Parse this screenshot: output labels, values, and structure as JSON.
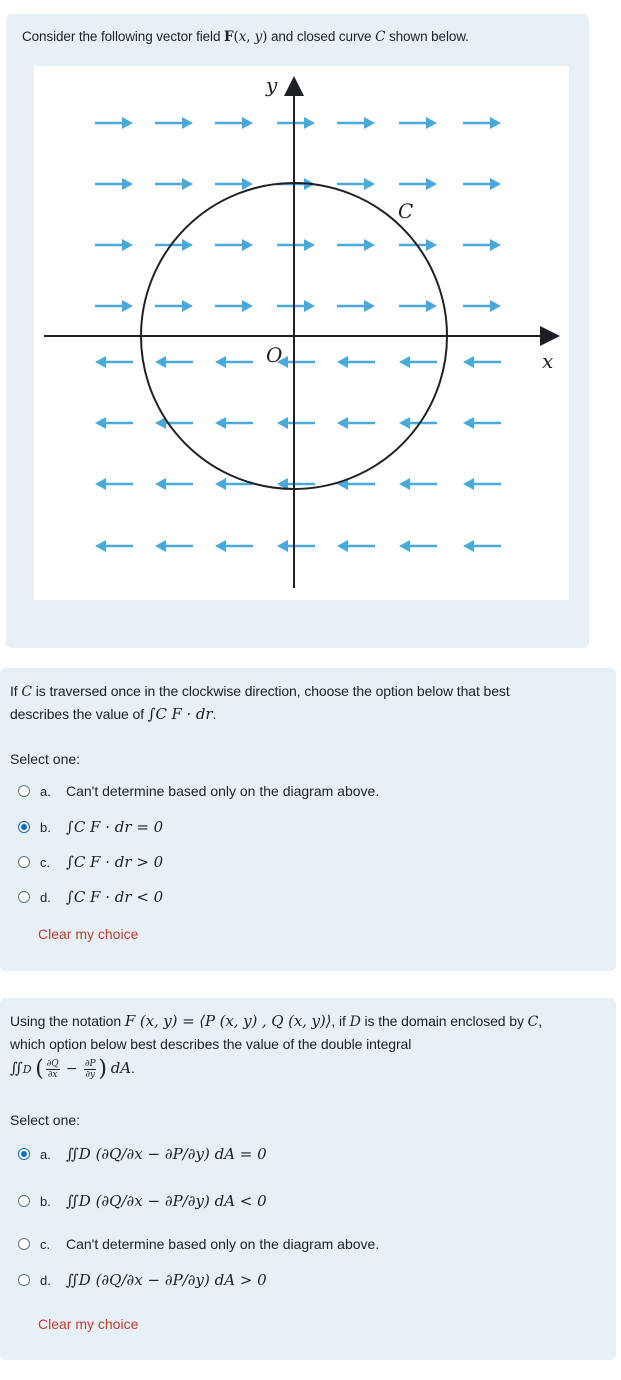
{
  "q1": {
    "prompt_pre": "Consider the following vector field ",
    "prompt_field": "F(x, y)",
    "prompt_mid": " and closed curve ",
    "prompt_curve": "C",
    "prompt_post": " shown below.",
    "diagram": {
      "axis_x": "x",
      "axis_y": "y",
      "origin": "O",
      "curve_label": "C",
      "arrow_color": "#4aa9d9"
    }
  },
  "q2": {
    "line1_pre": "If ",
    "line1_curve": "C",
    "line1_post": " is traversed once in the clockwise direction, choose the option below that best",
    "line2_pre": "describes the value of ",
    "line2_expr": "∫C F · dr",
    "line2_post": ".",
    "select_label": "Select one:",
    "options": [
      {
        "letter": "a.",
        "text": "Can't determine based only on the diagram above.",
        "checked": false
      },
      {
        "letter": "b.",
        "text": "∫C F · dr = 0",
        "checked": true
      },
      {
        "letter": "c.",
        "text": "∫C F · dr > 0",
        "checked": false
      },
      {
        "letter": "d.",
        "text": "∫C F · dr < 0",
        "checked": false
      }
    ],
    "clear_label": "Clear my choice"
  },
  "q3": {
    "line1_pre": "Using the notation ",
    "line1_expr": "F (x, y) = ⟨P (x, y) , Q (x, y)⟩",
    "line1_mid": ", if ",
    "line1_domain": "D",
    "line1_post": " is the domain enclosed by ",
    "line1_curve": "C",
    "line1_end": ",",
    "line2": "which option below best describes the value of the double integral",
    "select_label": "Select one:",
    "options": [
      {
        "letter": "a.",
        "text": "∬D (∂Q/∂x − ∂P/∂y) dA = 0",
        "checked": true
      },
      {
        "letter": "b.",
        "text": "∬D (∂Q/∂x − ∂P/∂y) dA < 0",
        "checked": false
      },
      {
        "letter": "c.",
        "text": "Can't determine based only on the diagram above.",
        "checked": false
      },
      {
        "letter": "d.",
        "text": "∬D (∂Q/∂x − ∂P/∂y) dA > 0",
        "checked": false
      }
    ],
    "clear_label": "Clear my choice"
  }
}
